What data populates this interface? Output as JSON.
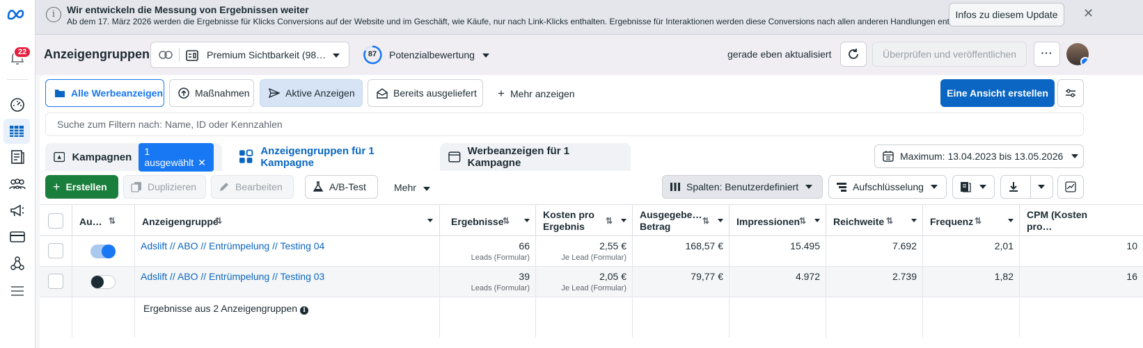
{
  "banner": {
    "title": "Wir entwickeln die Messung von Ergebnissen weiter",
    "text": "Ab dem 17. März 2026 werden die Ergebnisse für Klicks Conversions auf der Website und im Geschäft, wie Käufe, nur nach Link-Klicks enthalten. Ergebnisse für Interaktionen werden diese Conversions nach allen anderen Handlungen enthalten.",
    "button": "Infos zu diesem Update",
    "close": "✕"
  },
  "rail": {
    "notifications": "22"
  },
  "header": {
    "title": "Anzeigengruppen",
    "campaign": "Premium Sichtbarkeit (98…",
    "score": "87",
    "score_label": "Potenzialbewertung",
    "updated": "gerade eben aktualisiert",
    "publish": "Überprüfen und veröffentlichen",
    "more": "···"
  },
  "views": {
    "tabs": [
      "Alle Werbeanzeigen",
      "Maßnahmen",
      "Aktive Anzeigen",
      "Bereits ausgeliefert"
    ],
    "more": "Mehr anzeigen",
    "create": "Eine Ansicht erstellen"
  },
  "search": {
    "placeholder": "Suche zum Filtern nach: Name, ID oder Kennzahlen"
  },
  "levels": {
    "campaigns": "Kampagnen",
    "selected": "1 ausgewählt",
    "adsets": "Anzeigengruppen für 1 Kampagne",
    "ads": "Werbeanzeigen für 1 Kampagne",
    "date": "Maximum: 13.04.2023 bis 13.05.2026"
  },
  "toolbar": {
    "create": "Erstellen",
    "duplicate": "Duplizieren",
    "edit": "Bearbeiten",
    "abtest": "A/B-Test",
    "more": "Mehr",
    "columns": "Spalten: Benutzerdefiniert",
    "breakdown": "Aufschlüsselung"
  },
  "table": {
    "headers": {
      "status": "Au…",
      "name": "Anzeigengruppe",
      "results": "Ergebnisse",
      "cost_l1": "Kosten pro",
      "cost_l2": "Ergebnis",
      "spent_l1": "Ausgegebe…",
      "spent_l2": "Betrag",
      "impressions": "Impressionen",
      "reach": "Reichweite",
      "frequency": "Frequenz",
      "cpm_l1": "CPM (Kosten",
      "cpm_l2": "pro…"
    },
    "rows": [
      {
        "name": "Adslift // ABO // Entrümpelung // Testing 04",
        "active": true,
        "results": "66",
        "results_sub": "Leads (Formular)",
        "cost": "2,55 €",
        "cost_sub": "Je Lead (Formular)",
        "spent": "168,57 €",
        "impressions": "15.495",
        "reach": "7.692",
        "frequency": "2,01",
        "cpm": "10"
      },
      {
        "name": "Adslift // ABO // Entrümpelung // Testing 03",
        "active": false,
        "results": "39",
        "results_sub": "Leads (Formular)",
        "cost": "2,05 €",
        "cost_sub": "Je Lead (Formular)",
        "spent": "79,77 €",
        "impressions": "4.972",
        "reach": "2.739",
        "frequency": "1,82",
        "cpm": "16"
      }
    ],
    "summary": "Ergebnisse aus 2 Anzeigengruppen"
  },
  "colors": {
    "accent": "#1877f2",
    "primary_button": "#0a66c2",
    "create_button": "#1a7f3c"
  }
}
